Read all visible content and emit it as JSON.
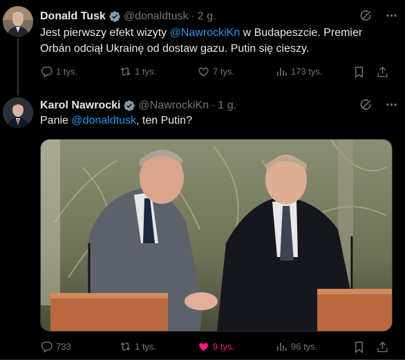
{
  "tweets": [
    {
      "name": "Donald Tusk",
      "handle": "@donaldtusk",
      "dot": "·",
      "time": "2 g.",
      "text_parts": [
        "Jest pierwszy efekt wizyty ",
        "@NawrockiKn",
        " w Budapeszcie. Premier Orbán odciął Ukrainę od dostaw gazu. Putin się cieszy."
      ],
      "stats": {
        "replies": "1 tys.",
        "reposts": "1 tys.",
        "likes": "7 tys.",
        "views": "173 tys."
      }
    },
    {
      "name": "Karol Nawrocki",
      "handle": "@NawrockiKn",
      "dot": "·",
      "time": "1 g.",
      "text_parts": [
        "Panie ",
        "@donaldtusk",
        ", ten Putin?"
      ],
      "stats": {
        "replies": "733",
        "reposts": "1 tys.",
        "likes": "9 tys.",
        "views": "96 tys."
      }
    }
  ],
  "colors": {
    "background": "#000000",
    "text": "#e7e9ea",
    "muted": "#71767b",
    "accent": "#1d9bf0",
    "like": "#f91880",
    "verified": "#829aab"
  },
  "icons": [
    "verified-badge-icon",
    "grok-icon",
    "more-icon",
    "reply-icon",
    "repost-icon",
    "like-icon",
    "views-icon",
    "bookmark-icon",
    "share-icon"
  ]
}
